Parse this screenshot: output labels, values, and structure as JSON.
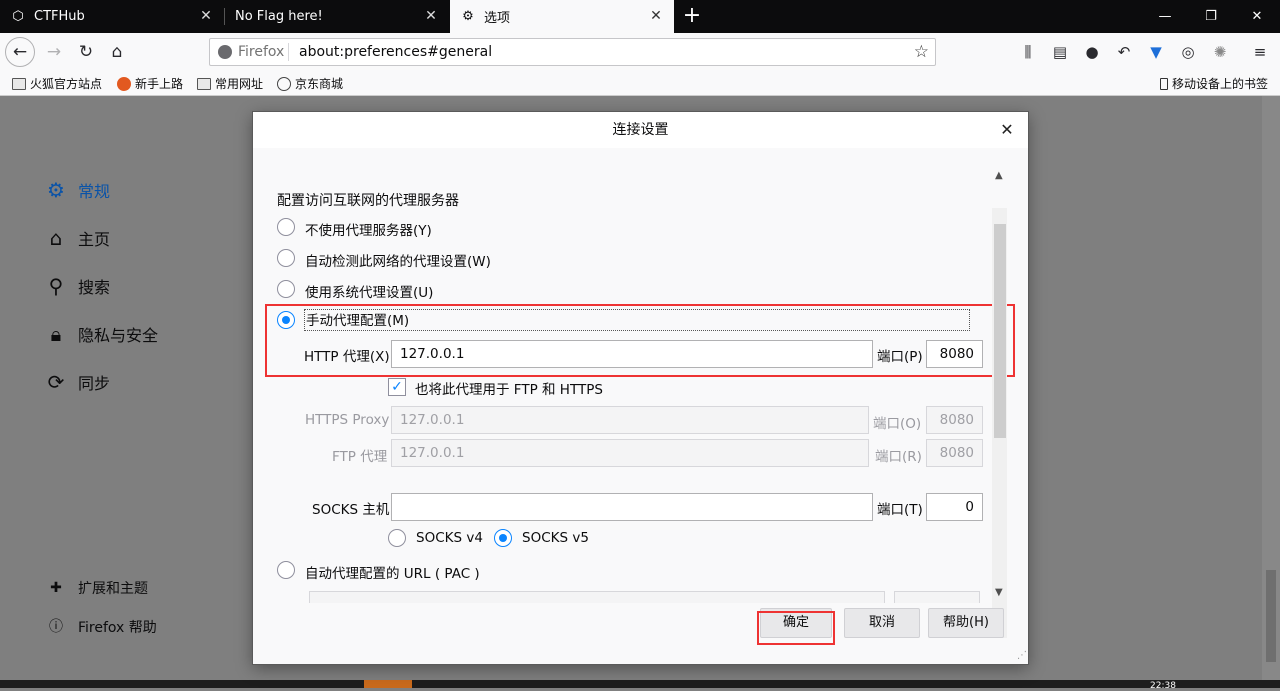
{
  "tabs": [
    {
      "label": "CTFHub",
      "icon": "ctfhub-icon"
    },
    {
      "label": "No Flag here!",
      "icon": ""
    },
    {
      "label": "选项",
      "icon": "gear-icon"
    }
  ],
  "navbar": {
    "identity_label": "Firefox",
    "url": "about:preferences#general"
  },
  "bookmarks": [
    {
      "label": "火狐官方站点",
      "icon": "folder-icon"
    },
    {
      "label": "新手上路",
      "icon": "firefox-icon"
    },
    {
      "label": "常用网址",
      "icon": "folder-icon"
    },
    {
      "label": "京东商城",
      "icon": "globe-icon"
    }
  ],
  "mobile_bookmarks": "移动设备上的书签",
  "sidebar": {
    "items": [
      {
        "label": "常规",
        "icon": "gear-icon"
      },
      {
        "label": "主页",
        "icon": "home-icon"
      },
      {
        "label": "搜索",
        "icon": "search-icon"
      },
      {
        "label": "隐私与安全",
        "icon": "lock-icon"
      },
      {
        "label": "同步",
        "icon": "sync-icon"
      }
    ],
    "footer": [
      {
        "label": "扩展和主题",
        "icon": "puzzle-icon"
      },
      {
        "label": "Firefox 帮助",
        "icon": "help-icon"
      }
    ]
  },
  "dialog": {
    "title": "连接设置",
    "section_title": "配置访问互联网的代理服务器",
    "proxy_options": {
      "none": "不使用代理服务器(Y)",
      "auto_detect": "自动检测此网络的代理设置(W)",
      "system": "使用系统代理设置(U)",
      "manual": "手动代理配置(M)"
    },
    "http": {
      "label": "HTTP 代理(X)",
      "value": "127.0.0.1",
      "port_label": "端口(P)",
      "port": "8080"
    },
    "share_checkbox": "也将此代理用于 FTP 和 HTTPS",
    "https": {
      "label": "HTTPS Proxy",
      "value": "127.0.0.1",
      "port_label": "端口(O)",
      "port": "8080"
    },
    "ftp": {
      "label": "FTP 代理",
      "value": "127.0.0.1",
      "port_label": "端口(R)",
      "port": "8080"
    },
    "socks": {
      "label": "SOCKS 主机",
      "value": "",
      "port_label": "端口(T)",
      "port": "0"
    },
    "socks_v4": "SOCKS v4",
    "socks_v5": "SOCKS v5",
    "pac_label": "自动代理配置的 URL ( PAC )",
    "buttons": {
      "ok": "确定",
      "cancel": "取消",
      "help": "帮助(H)"
    }
  },
  "taskbar_clock": "22:38"
}
